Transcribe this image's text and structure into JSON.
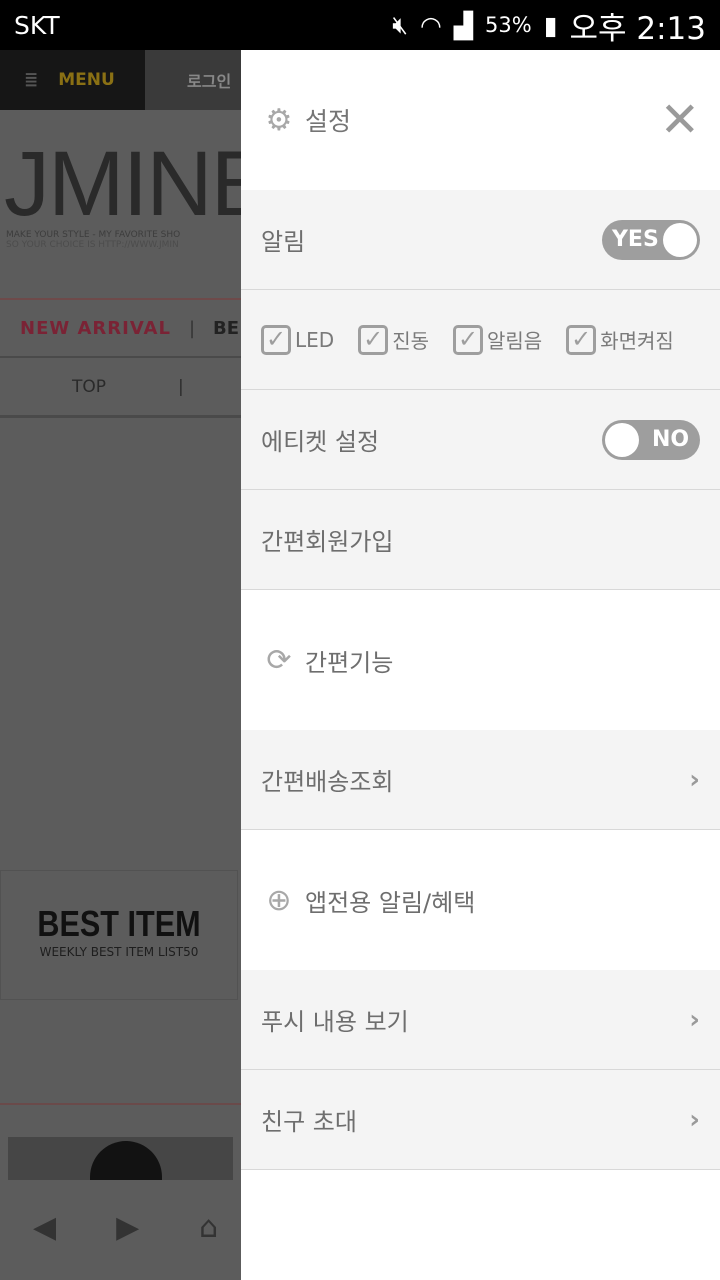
{
  "status_bar": {
    "carrier": "SKT",
    "battery": "53%",
    "time": "오후 2:13"
  },
  "background_page": {
    "menu_label": "MENU",
    "login_label": "로그인",
    "logo": "JMINE",
    "tagline1": "MAKE YOUR STYLE - MY FAVORITE SHO",
    "tagline2": "SO YOUR CHOICE IS HTTP://WWW.JMIN",
    "nav1": [
      "NEW ARRIVAL",
      "|",
      "BE"
    ],
    "nav2": [
      "TOP",
      "|"
    ],
    "banner_title": "BEST ITEM",
    "banner_subtitle": "WEEKLY BEST ITEM LIST50"
  },
  "drawer": {
    "title": "설정",
    "close_icon": "close-icon",
    "notification": {
      "label": "알림",
      "toggle": "YES",
      "on": true
    },
    "checkboxes": [
      {
        "label": "LED",
        "checked": true
      },
      {
        "label": "진동",
        "checked": true
      },
      {
        "label": "알림음",
        "checked": true
      },
      {
        "label": "화면켜짐",
        "checked": true
      }
    ],
    "etiquette": {
      "label": "에티켓 설정",
      "toggle": "NO",
      "on": false
    },
    "signup": "간편회원가입",
    "quick_section": "간편기능",
    "delivery": "간편배송조회",
    "app_section": "앱전용 알림/혜택",
    "push_view": "푸시 내용 보기",
    "invite": "친구 초대"
  }
}
